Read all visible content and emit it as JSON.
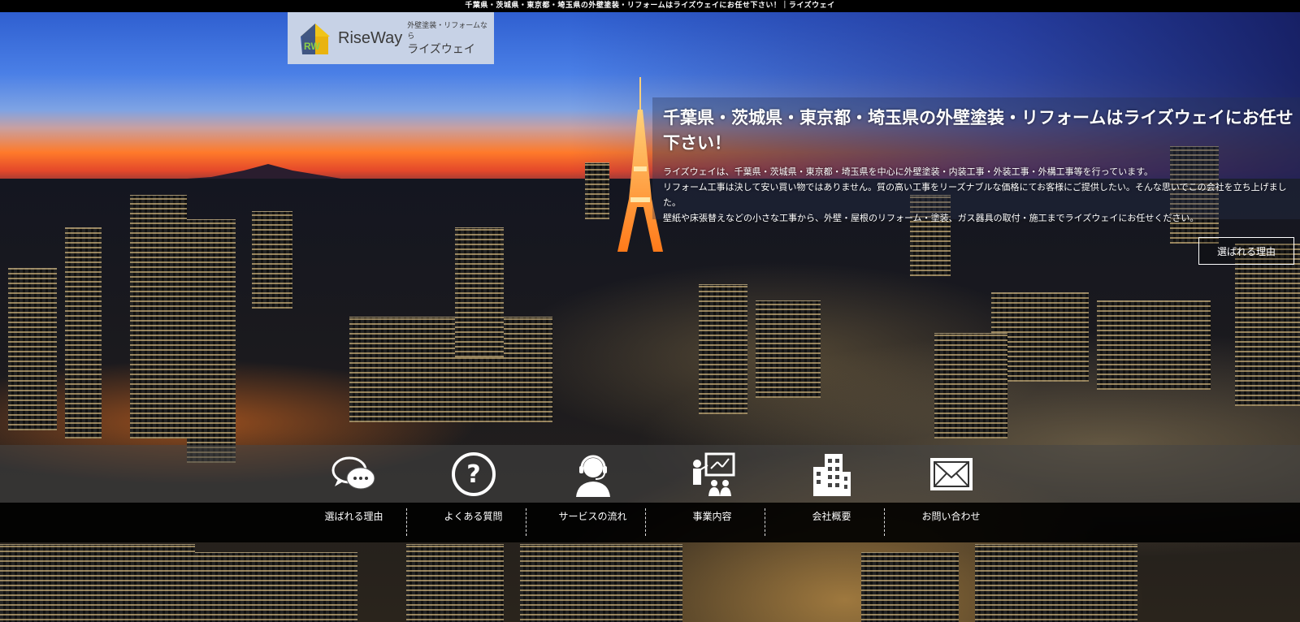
{
  "header": {
    "site_title": "千葉県・茨城県・東京都・埼玉県の外壁塗装・リフォームはライズウェイにお任せ下さい！｜ライズウェイ"
  },
  "logo": {
    "mark_text": "RW",
    "brand": "RiseWay",
    "tagline_small": "外壁塗装・リフォームなら",
    "tagline_large": "ライズウェイ"
  },
  "intro": {
    "title": "千葉県・茨城県・東京都・埼玉県の外壁塗装・リフォームはライズウェイにお任せ下さい！",
    "paragraphs": [
      "ライズウェイは、千葉県・茨城県・東京都・埼玉県を中心に外壁塗装・内装工事・外装工事・外構工事等を行っています。",
      "リフォーム工事は決して安い買い物ではありません。質の高い工事をリーズナブルな価格にてお客様にご提供したい。そんな思いでこの会社を立ち上げました。",
      "壁紙や床張替えなどの小さな工事から、外壁・屋根のリフォーム・塗装、ガス器具の取付・施工までライズウェイにお任せください。"
    ],
    "button_label": "選ばれる理由"
  },
  "nav": {
    "items": [
      {
        "label": "選ばれる理由",
        "icon": "speech-bubbles-icon"
      },
      {
        "label": "よくある質問",
        "icon": "question-icon"
      },
      {
        "label": "サービスの流れ",
        "icon": "operator-headset-icon"
      },
      {
        "label": "事業内容",
        "icon": "presentation-icon"
      },
      {
        "label": "会社概要",
        "icon": "building-icon"
      },
      {
        "label": "お問い合わせ",
        "icon": "mail-icon"
      }
    ]
  },
  "colors": {
    "topbar": "#000000",
    "navbar": "#000000",
    "logo_bg": "#c7d2e6",
    "text": "#ffffff"
  }
}
